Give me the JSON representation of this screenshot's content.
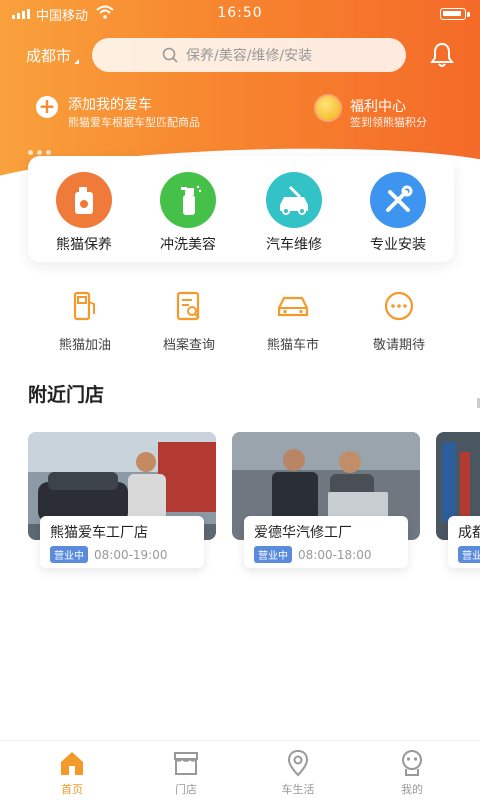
{
  "status_bar": {
    "carrier": "中国移动",
    "time": "16:50"
  },
  "header": {
    "city": "成都市",
    "search_placeholder": "保养/美容/维修/安装",
    "add_car_title": "添加我的爱车",
    "add_car_subtitle": "熊猫爱车根据车型匹配商品",
    "welfare_title": "福利中心",
    "welfare_subtitle": "签到领熊猫积分"
  },
  "services": [
    {
      "label": "熊猫保养",
      "icon": "oil-can-icon",
      "color": "#f07a3a"
    },
    {
      "label": "冲洗美容",
      "icon": "spray-bottle-icon",
      "color": "#45c14a"
    },
    {
      "label": "汽车维修",
      "icon": "car-repair-icon",
      "color": "#33c3c6"
    },
    {
      "label": "专业安装",
      "icon": "tools-icon",
      "color": "#3d95f0"
    }
  ],
  "shortcuts": [
    {
      "label": "熊猫加油",
      "icon": "fuel-pump-icon"
    },
    {
      "label": "档案查询",
      "icon": "document-search-icon"
    },
    {
      "label": "熊猫车市",
      "icon": "car-icon"
    },
    {
      "label": "敬请期待",
      "icon": "more-icon"
    }
  ],
  "nearby": {
    "title": "附近门店",
    "stores": [
      {
        "name": "熊猫爱车工厂店",
        "status": "营业中",
        "hours": "08:00-19:00"
      },
      {
        "name": "爱德华汽修工厂",
        "status": "营业中",
        "hours": "08:00-18:00"
      },
      {
        "name": "成都",
        "status": "营业中",
        "hours": ""
      }
    ]
  },
  "tabbar": [
    {
      "label": "首页",
      "icon": "home-icon",
      "active": true
    },
    {
      "label": "门店",
      "icon": "store-icon",
      "active": false
    },
    {
      "label": "车生活",
      "icon": "location-pin-icon",
      "active": false
    },
    {
      "label": "我的",
      "icon": "profile-icon",
      "active": false
    }
  ],
  "colors": {
    "accent": "#f7862f",
    "active_tab": "#f49a2b",
    "badge": "#5a8bdc"
  }
}
